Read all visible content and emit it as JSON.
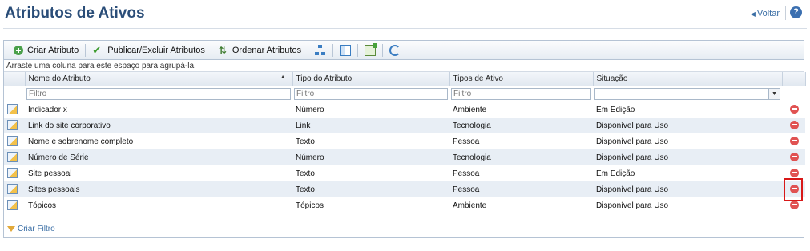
{
  "header": {
    "title": "Atributos de Ativos",
    "back_label": "Voltar",
    "help_label": "?"
  },
  "toolbar": {
    "create_label": "Criar Atributo",
    "publish_label": "Publicar/Excluir Atributos",
    "order_label": "Ordenar Atributos",
    "icons": [
      "hierarchy-icon",
      "columns-icon",
      "export-icon",
      "refresh-icon"
    ]
  },
  "grid": {
    "group_hint": "Arraste uma coluna para este espaço para agrupá-la.",
    "columns": [
      "Nome do Atributo",
      "Tipo do Atributo",
      "Tipos de Ativo",
      "Situação"
    ],
    "filter_placeholder": "Filtro",
    "rows": [
      {
        "name": "Indicador x",
        "type": "Número",
        "asset": "Ambiente",
        "status": "Em Edição"
      },
      {
        "name": "Link do site corporativo",
        "type": "Link",
        "asset": "Tecnologia",
        "status": "Disponível para Uso"
      },
      {
        "name": "Nome e sobrenome completo",
        "type": "Texto",
        "asset": "Pessoa",
        "status": "Disponível para Uso"
      },
      {
        "name": "Número de Série",
        "type": "Número",
        "asset": "Tecnologia",
        "status": "Disponível para Uso"
      },
      {
        "name": "Site pessoal",
        "type": "Texto",
        "asset": "Pessoa",
        "status": "Em Edição"
      },
      {
        "name": "Sites pessoais",
        "type": "Texto",
        "asset": "Pessoa",
        "status": "Disponível para Uso"
      },
      {
        "name": "Tópicos",
        "type": "Tópicos",
        "asset": "Ambiente",
        "status": "Disponível para Uso"
      }
    ],
    "create_filter_label": "Criar Filtro"
  },
  "colors": {
    "title": "#2a4d78",
    "link": "#3a6ea5",
    "row_alt": "#e8eef5",
    "remove": "#e05252",
    "highlight": "#d81818"
  }
}
